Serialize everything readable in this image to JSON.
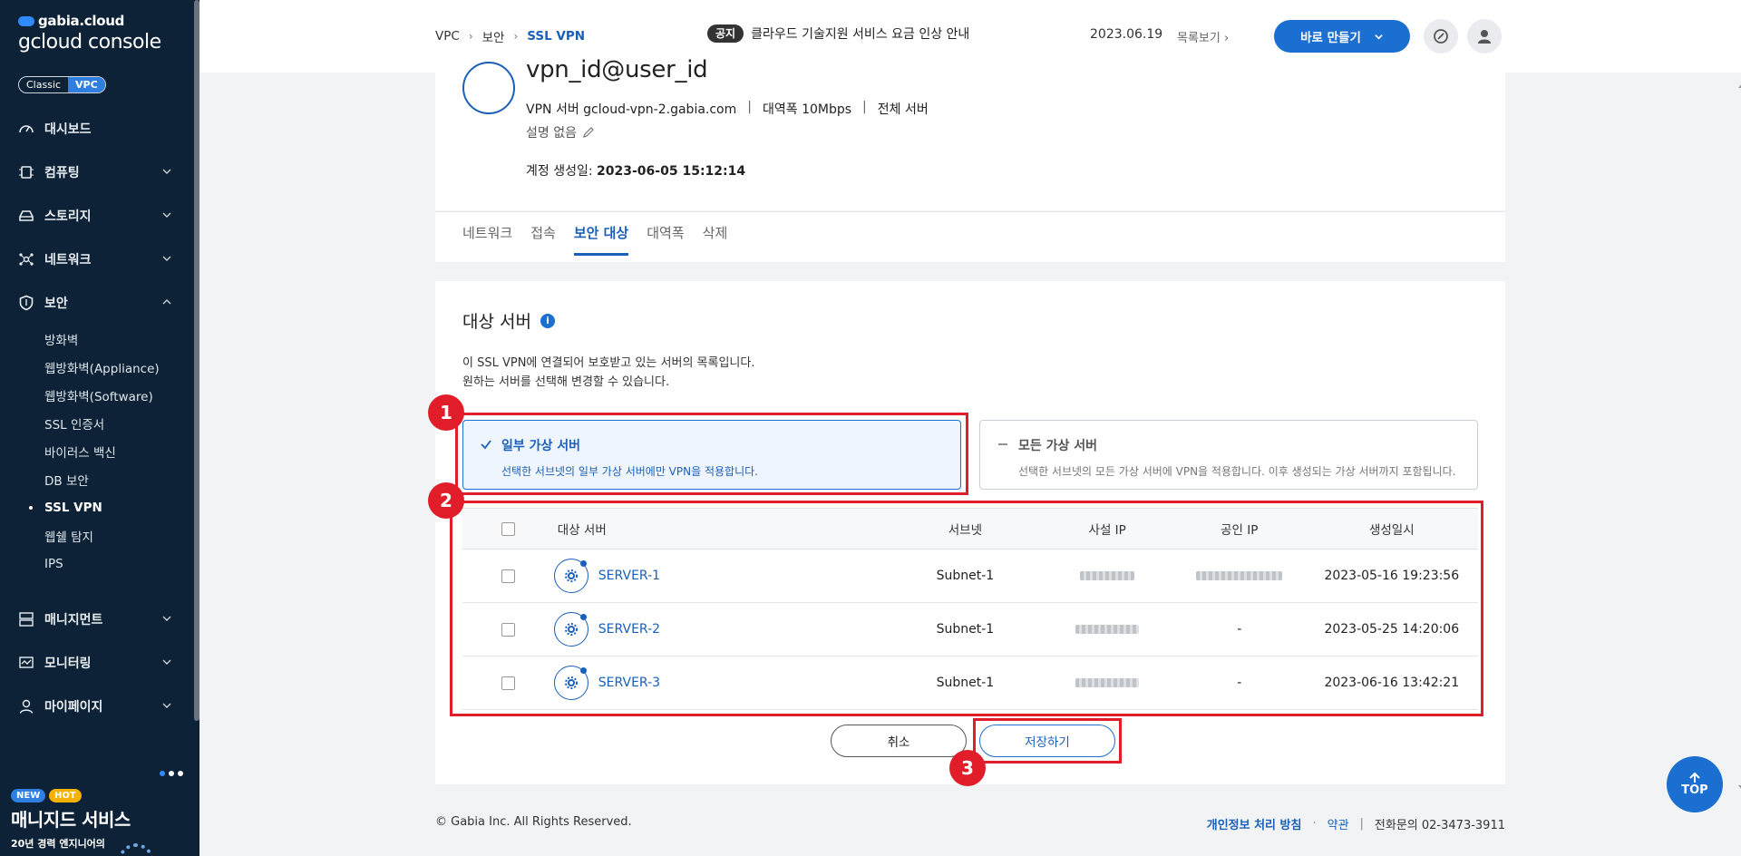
{
  "sidebar": {
    "brand_top": "gabia.cloud",
    "brand_main": "gcloud console",
    "mode": {
      "classic": "Classic",
      "vpc": "VPC"
    },
    "items": [
      {
        "label": "대시보드",
        "icon": "gauge-icon"
      },
      {
        "label": "컴퓨팅",
        "icon": "chip-icon"
      },
      {
        "label": "스토리지",
        "icon": "drive-icon"
      },
      {
        "label": "네트워크",
        "icon": "network-icon"
      },
      {
        "label": "보안",
        "icon": "shield-icon"
      }
    ],
    "security_sub": [
      "방화벽",
      "웹방화벽(Appliance)",
      "웹방화벽(Software)",
      "SSL 인증서",
      "바이러스 백신",
      "DB 보안",
      "SSL VPN",
      "웹쉘 탐지",
      "IPS"
    ],
    "lower_items": [
      {
        "label": "매니지먼트",
        "icon": "server-icon"
      },
      {
        "label": "모니터링",
        "icon": "monitor-icon"
      },
      {
        "label": "마이페이지",
        "icon": "user-icon"
      }
    ],
    "promo": {
      "badge_new": "NEW",
      "badge_hot": "HOT",
      "title": "매니지드 서비스",
      "subtitle": "20년 경력 엔지니어의"
    }
  },
  "header": {
    "breadcrumb": [
      "VPC",
      "보안",
      "SSL VPN"
    ],
    "notice_tag": "공지",
    "notice_text": "클라우드 기술지원 서비스 요금 인상 안내",
    "notice_date": "2023.06.19",
    "notice_more": "목록보기",
    "create_button": "바로 만들기"
  },
  "detail": {
    "title": "vpn_id@user_id",
    "server_label": "VPN 서버",
    "server_value": "gcloud-vpn-2.gabia.com",
    "bandwidth_label": "대역폭",
    "bandwidth_value": "10Mbps",
    "scope": "전체 서버",
    "description": "설명 없음",
    "created_label": "계정 생성일:",
    "created_value": "2023-06-05 15:12:14"
  },
  "tabs": [
    "네트워크",
    "접속",
    "보안 대상",
    "대역폭",
    "삭제"
  ],
  "section": {
    "title": "대상 서버",
    "desc_line1": "이 SSL VPN에 연결되어 보호받고 있는 서버의 목록입니다.",
    "desc_line2": "원하는 서버를 선택해 변경할 수 있습니다."
  },
  "options": {
    "partial": {
      "title": "일부 가상 서버",
      "desc": "선택한 서브넷의 일부 가상 서버에만 VPN을 적용합니다."
    },
    "all": {
      "title": "모든 가상 서버",
      "desc": "선택한 서브넷의 모든 가상 서버에 VPN을 적용합니다. 이후 생성되는 가상 서버까지 포함됩니다."
    }
  },
  "table": {
    "headers": [
      "대상 서버",
      "서브넷",
      "사설 IP",
      "공인 IP",
      "생성일시"
    ],
    "rows": [
      {
        "name": "SERVER-1",
        "subnet": "Subnet-1",
        "public_ip": "",
        "created": "2023-05-16 19:23:56"
      },
      {
        "name": "SERVER-2",
        "subnet": "Subnet-1",
        "public_ip": "-",
        "created": "2023-05-25 14:20:06"
      },
      {
        "name": "SERVER-3",
        "subnet": "Subnet-1",
        "public_ip": "-",
        "created": "2023-06-16 13:42:21"
      }
    ]
  },
  "buttons": {
    "cancel": "취소",
    "save": "저장하기"
  },
  "annotations": [
    "1",
    "2",
    "3"
  ],
  "footer": {
    "copyright": "© Gabia Inc. All Rights Reserved.",
    "privacy": "개인정보 처리 방침",
    "dot": "·",
    "terms": "약관",
    "bar": "|",
    "contact": "전화문의  02-3473-3911"
  },
  "top_button": "TOP",
  "colors": {
    "accent": "#1a6fd0",
    "sidebar": "#0d2236",
    "highlight": "#e11d2a"
  }
}
